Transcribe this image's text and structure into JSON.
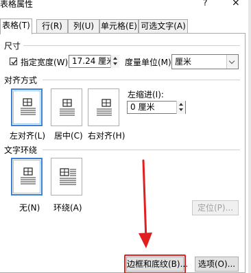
{
  "window": {
    "title": "表格属性",
    "help": "?",
    "close": "×"
  },
  "tabs": [
    {
      "label": "表格(T)",
      "active": true
    },
    {
      "label": "行(R)",
      "active": false
    },
    {
      "label": "列(U)",
      "active": false
    },
    {
      "label": "单元格(E)",
      "active": false
    },
    {
      "label": "可选文字(A)",
      "active": false
    }
  ],
  "size": {
    "section": "尺寸",
    "specify_width_label": "指定宽度(W):",
    "specify_width_checked": true,
    "width_value": "17.24 厘米",
    "unit_label": "度量单位(M):",
    "unit_value": "厘米"
  },
  "alignment": {
    "section": "对齐方式",
    "options": [
      {
        "label": "左对齐(L)",
        "selected": true,
        "icon": "align-left-icon"
      },
      {
        "label": "居中(C)",
        "selected": false,
        "icon": "align-center-icon"
      },
      {
        "label": "右对齐(H)",
        "selected": false,
        "icon": "align-right-icon"
      }
    ],
    "indent_label": "左缩进(I):",
    "indent_value": "0 厘米"
  },
  "wrapping": {
    "section": "文字环绕",
    "options": [
      {
        "label": "无(N)",
        "selected": true,
        "icon": "wrap-none-icon"
      },
      {
        "label": "环绕(A)",
        "selected": false,
        "icon": "wrap-around-icon"
      }
    ],
    "position_button": "定位(P)...",
    "position_enabled": false
  },
  "footer": {
    "borders_button": "边框和底纹(B)...",
    "options_button": "选项(O)..."
  },
  "annotation": {
    "color": "#e02020"
  }
}
